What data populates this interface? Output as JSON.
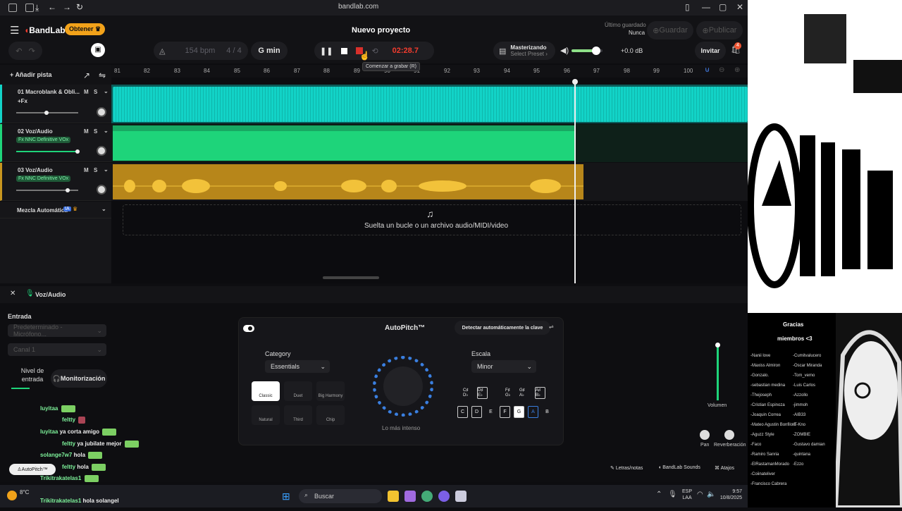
{
  "browser": {
    "url": "bandlab.com"
  },
  "header": {
    "logo": "BandLab",
    "get_label": "Obtener",
    "project_title": "Nuevo proyecto",
    "saved_label": "Último guardado",
    "saved_value": "Nunca",
    "save_label": "Guardar",
    "publish_label": "Publicar"
  },
  "toolbar": {
    "tempo": "154 bpm",
    "time_sig": "4 / 4",
    "key": "G min",
    "time": "02:28.7",
    "mastering_label": "Masterizando",
    "mastering_preset": "Select Preset ›",
    "volume_db": "+0.0 dB",
    "invite_label": "Invitar",
    "invite_badge": "4",
    "tooltip": "Comenzar a grabar (R)"
  },
  "tracks_header": {
    "add_track": "Añadir pista"
  },
  "ruler": [
    "81",
    "82",
    "83",
    "84",
    "85",
    "86",
    "87",
    "88",
    "89",
    "90",
    "91",
    "92",
    "93",
    "94",
    "95",
    "96",
    "97",
    "98",
    "99",
    "100"
  ],
  "tracks": [
    {
      "name": "01 Macroblank & Obli...",
      "fx": "+Fx",
      "m": "M",
      "s": "S",
      "color": "#12d3c7"
    },
    {
      "name": "02 Voz/Audio",
      "fx": "Fx NNC Definitive VOx",
      "m": "M",
      "s": "S",
      "color": "#1ed47a"
    },
    {
      "name": "03 Voz/Audio",
      "fx": "Fx NNC Definitive VOx",
      "m": "M",
      "s": "S",
      "color": "#c8961f"
    }
  ],
  "automix": {
    "label": "Mezcla Automática",
    "badge": "IA"
  },
  "dropzone": {
    "text": "Suelta un bucle o un archivo audio/MIDI/video"
  },
  "panel": {
    "track_title": "Voz/Audio",
    "input_label": "Entrada",
    "input_device": "Predeterminado - Micrófono...",
    "channel": "Canal 1",
    "level_label": "Nivel de entrada",
    "monitor_label": "Monitorización",
    "autopitch_title": "AutoPitch™",
    "detect_key": "Detectar automáticamente la clave",
    "category_label": "Category",
    "category_value": "Essentials",
    "scale_label": "Escala",
    "scale_value": "Minor",
    "knob_label": "Lo más intenso",
    "tiles": [
      "Classic",
      "Duet",
      "Big Harmony",
      "Natural",
      "Third",
      "Chip"
    ],
    "keys_top": [
      "C♯ D♭",
      "D♯ E♭",
      "F♯ G♭",
      "G♯ A♭",
      "A♯ B♭"
    ],
    "keys_bottom": [
      "C",
      "D",
      "E",
      "F",
      "G",
      "A",
      "B"
    ],
    "volume_label": "Volumen",
    "pan_label": "Pan",
    "reverb_label": "Reverberación",
    "lyrics_label": "Letras/notas",
    "sounds_label": "BandLab Sounds",
    "shortcuts_label": "Atajos",
    "chip_label": "AutoPitch™"
  },
  "chat": [
    {
      "user": "luyitaa",
      "msg": ""
    },
    {
      "user": "feltty",
      "msg": ""
    },
    {
      "user": "luyitaa",
      "msg": "ya corta amigo"
    },
    {
      "user": "feltty",
      "msg": "ya jubilate mejor"
    },
    {
      "user": "solange7w7",
      "msg": "hola"
    },
    {
      "user": "feltty",
      "msg": "hola"
    },
    {
      "user": "solange7w7",
      "msg": ""
    },
    {
      "user": "Trikitrakatelas1",
      "msg": ""
    },
    {
      "user": "Trikitrakatelas1",
      "msg": "hola solangel"
    }
  ],
  "taskbar": {
    "search": "Buscar",
    "temp": "8°C",
    "lang": "ESP",
    "lang2": "LAA",
    "time": "9:57",
    "date": "10/8/2025"
  },
  "overlay": {
    "thanks": "Gracias",
    "members": "miembros <3",
    "col1": [
      "-Nanii love",
      "-Maxiss Almiron",
      "-Gonzalo.",
      "-sebastian medina",
      "-Thejoseph",
      "-Cristian Espinoza",
      "-Joaquin Correa",
      "-Mateo Agustin Bonfilotti",
      "-Aguzz Style",
      "-Faco",
      "-Ramiro Sanria",
      "-ElRastamanMorado",
      "-Coiinateliver",
      "-Francisco Cabrera"
    ],
    "col2": [
      "-Cumitvalucero",
      "-Oscar Miranda",
      "-Tom_vemo",
      "-Luis Carlos",
      "-Azzollo",
      "-jimmoh",
      "-AIB33",
      "-T-Kno",
      "-ZOMBIE",
      "-Gustavo damian",
      "-quintana",
      "-Ezzo"
    ]
  }
}
